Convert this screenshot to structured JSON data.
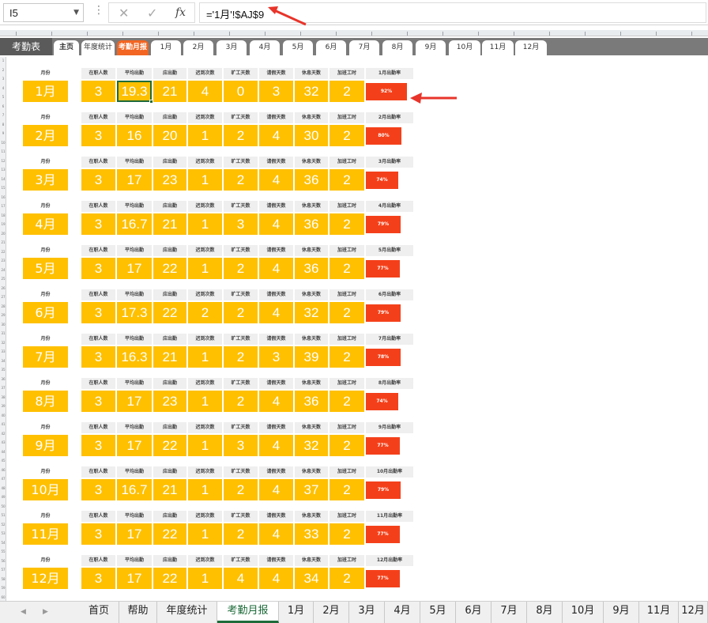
{
  "formula_bar": {
    "name_box": "I5",
    "formula": "='1月'!$AJ$9",
    "fx": "fx"
  },
  "top_nav": {
    "title": "考勤表",
    "tabs": [
      {
        "label": "主页",
        "type": "main"
      },
      {
        "label": "年度统计",
        "type": "normal"
      },
      {
        "label": "考勤月报",
        "type": "active"
      },
      {
        "label": "1月",
        "type": "normal"
      },
      {
        "label": "2月",
        "type": "normal"
      },
      {
        "label": "3月",
        "type": "normal"
      },
      {
        "label": "4月",
        "type": "normal"
      },
      {
        "label": "5月",
        "type": "normal"
      },
      {
        "label": "6月",
        "type": "normal"
      },
      {
        "label": "7月",
        "type": "normal"
      },
      {
        "label": "8月",
        "type": "normal"
      },
      {
        "label": "9月",
        "type": "normal"
      },
      {
        "label": "10月",
        "type": "normal"
      },
      {
        "label": "11月",
        "type": "normal"
      },
      {
        "label": "12月",
        "type": "normal"
      }
    ]
  },
  "headers": {
    "month": "月份",
    "staff": "在职人数",
    "avg": "平均出勤",
    "due": "应出勤",
    "late": "迟到次数",
    "absent": "旷工天数",
    "leave": "请假天数",
    "rest": "休息天数",
    "overtime": "加班工时"
  },
  "months": [
    {
      "month": "1月",
      "staff": "3",
      "avg": "19.3",
      "due": "21",
      "late": "4",
      "absent": "0",
      "leave": "3",
      "rest": "32",
      "overtime": "2",
      "rate_label": "1月出勤率",
      "rate": "92%",
      "rate_fraction": 0.92
    },
    {
      "month": "2月",
      "staff": "3",
      "avg": "16",
      "due": "20",
      "late": "1",
      "absent": "2",
      "leave": "4",
      "rest": "30",
      "overtime": "2",
      "rate_label": "2月出勤率",
      "rate": "80%",
      "rate_fraction": 0.8
    },
    {
      "month": "3月",
      "staff": "3",
      "avg": "17",
      "due": "23",
      "late": "1",
      "absent": "2",
      "leave": "4",
      "rest": "36",
      "overtime": "2",
      "rate_label": "3月出勤率",
      "rate": "74%",
      "rate_fraction": 0.74
    },
    {
      "month": "4月",
      "staff": "3",
      "avg": "16.7",
      "due": "21",
      "late": "1",
      "absent": "3",
      "leave": "4",
      "rest": "36",
      "overtime": "2",
      "rate_label": "4月出勤率",
      "rate": "79%",
      "rate_fraction": 0.79
    },
    {
      "month": "5月",
      "staff": "3",
      "avg": "17",
      "due": "22",
      "late": "1",
      "absent": "2",
      "leave": "4",
      "rest": "36",
      "overtime": "2",
      "rate_label": "5月出勤率",
      "rate": "77%",
      "rate_fraction": 0.77
    },
    {
      "month": "6月",
      "staff": "3",
      "avg": "17.3",
      "due": "22",
      "late": "2",
      "absent": "2",
      "leave": "4",
      "rest": "32",
      "overtime": "2",
      "rate_label": "6月出勤率",
      "rate": "79%",
      "rate_fraction": 0.79
    },
    {
      "month": "7月",
      "staff": "3",
      "avg": "16.3",
      "due": "21",
      "late": "1",
      "absent": "2",
      "leave": "3",
      "rest": "39",
      "overtime": "2",
      "rate_label": "7月出勤率",
      "rate": "78%",
      "rate_fraction": 0.78
    },
    {
      "month": "8月",
      "staff": "3",
      "avg": "17",
      "due": "23",
      "late": "1",
      "absent": "2",
      "leave": "4",
      "rest": "36",
      "overtime": "2",
      "rate_label": "8月出勤率",
      "rate": "74%",
      "rate_fraction": 0.74
    },
    {
      "month": "9月",
      "staff": "3",
      "avg": "17",
      "due": "22",
      "late": "1",
      "absent": "3",
      "leave": "4",
      "rest": "32",
      "overtime": "2",
      "rate_label": "9月出勤率",
      "rate": "77%",
      "rate_fraction": 0.77
    },
    {
      "month": "10月",
      "staff": "3",
      "avg": "16.7",
      "due": "21",
      "late": "1",
      "absent": "2",
      "leave": "4",
      "rest": "37",
      "overtime": "2",
      "rate_label": "10月出勤率",
      "rate": "79%",
      "rate_fraction": 0.79
    },
    {
      "month": "11月",
      "staff": "3",
      "avg": "17",
      "due": "22",
      "late": "1",
      "absent": "2",
      "leave": "4",
      "rest": "33",
      "overtime": "2",
      "rate_label": "11月出勤率",
      "rate": "77%",
      "rate_fraction": 0.77
    },
    {
      "month": "12月",
      "staff": "3",
      "avg": "17",
      "due": "22",
      "late": "1",
      "absent": "4",
      "leave": "4",
      "rest": "34",
      "overtime": "2",
      "rate_label": "12月出勤率",
      "rate": "77%",
      "rate_fraction": 0.77
    }
  ],
  "sheet_tabs": [
    {
      "label": "首页"
    },
    {
      "label": "帮助"
    },
    {
      "label": "年度统计"
    },
    {
      "label": "考勤月报",
      "active": true
    },
    {
      "label": "1月"
    },
    {
      "label": "2月"
    },
    {
      "label": "3月"
    },
    {
      "label": "4月"
    },
    {
      "label": "5月"
    },
    {
      "label": "6月"
    },
    {
      "label": "7月"
    },
    {
      "label": "8月"
    },
    {
      "label": "10月"
    },
    {
      "label": "9月"
    },
    {
      "label": "11月"
    },
    {
      "label": "12月"
    }
  ],
  "colors": {
    "cell_fill": "#ffc000",
    "rate_fill": "#f4401a",
    "active_tab": "#f26522",
    "annotation_arrow": "#e8342a"
  }
}
